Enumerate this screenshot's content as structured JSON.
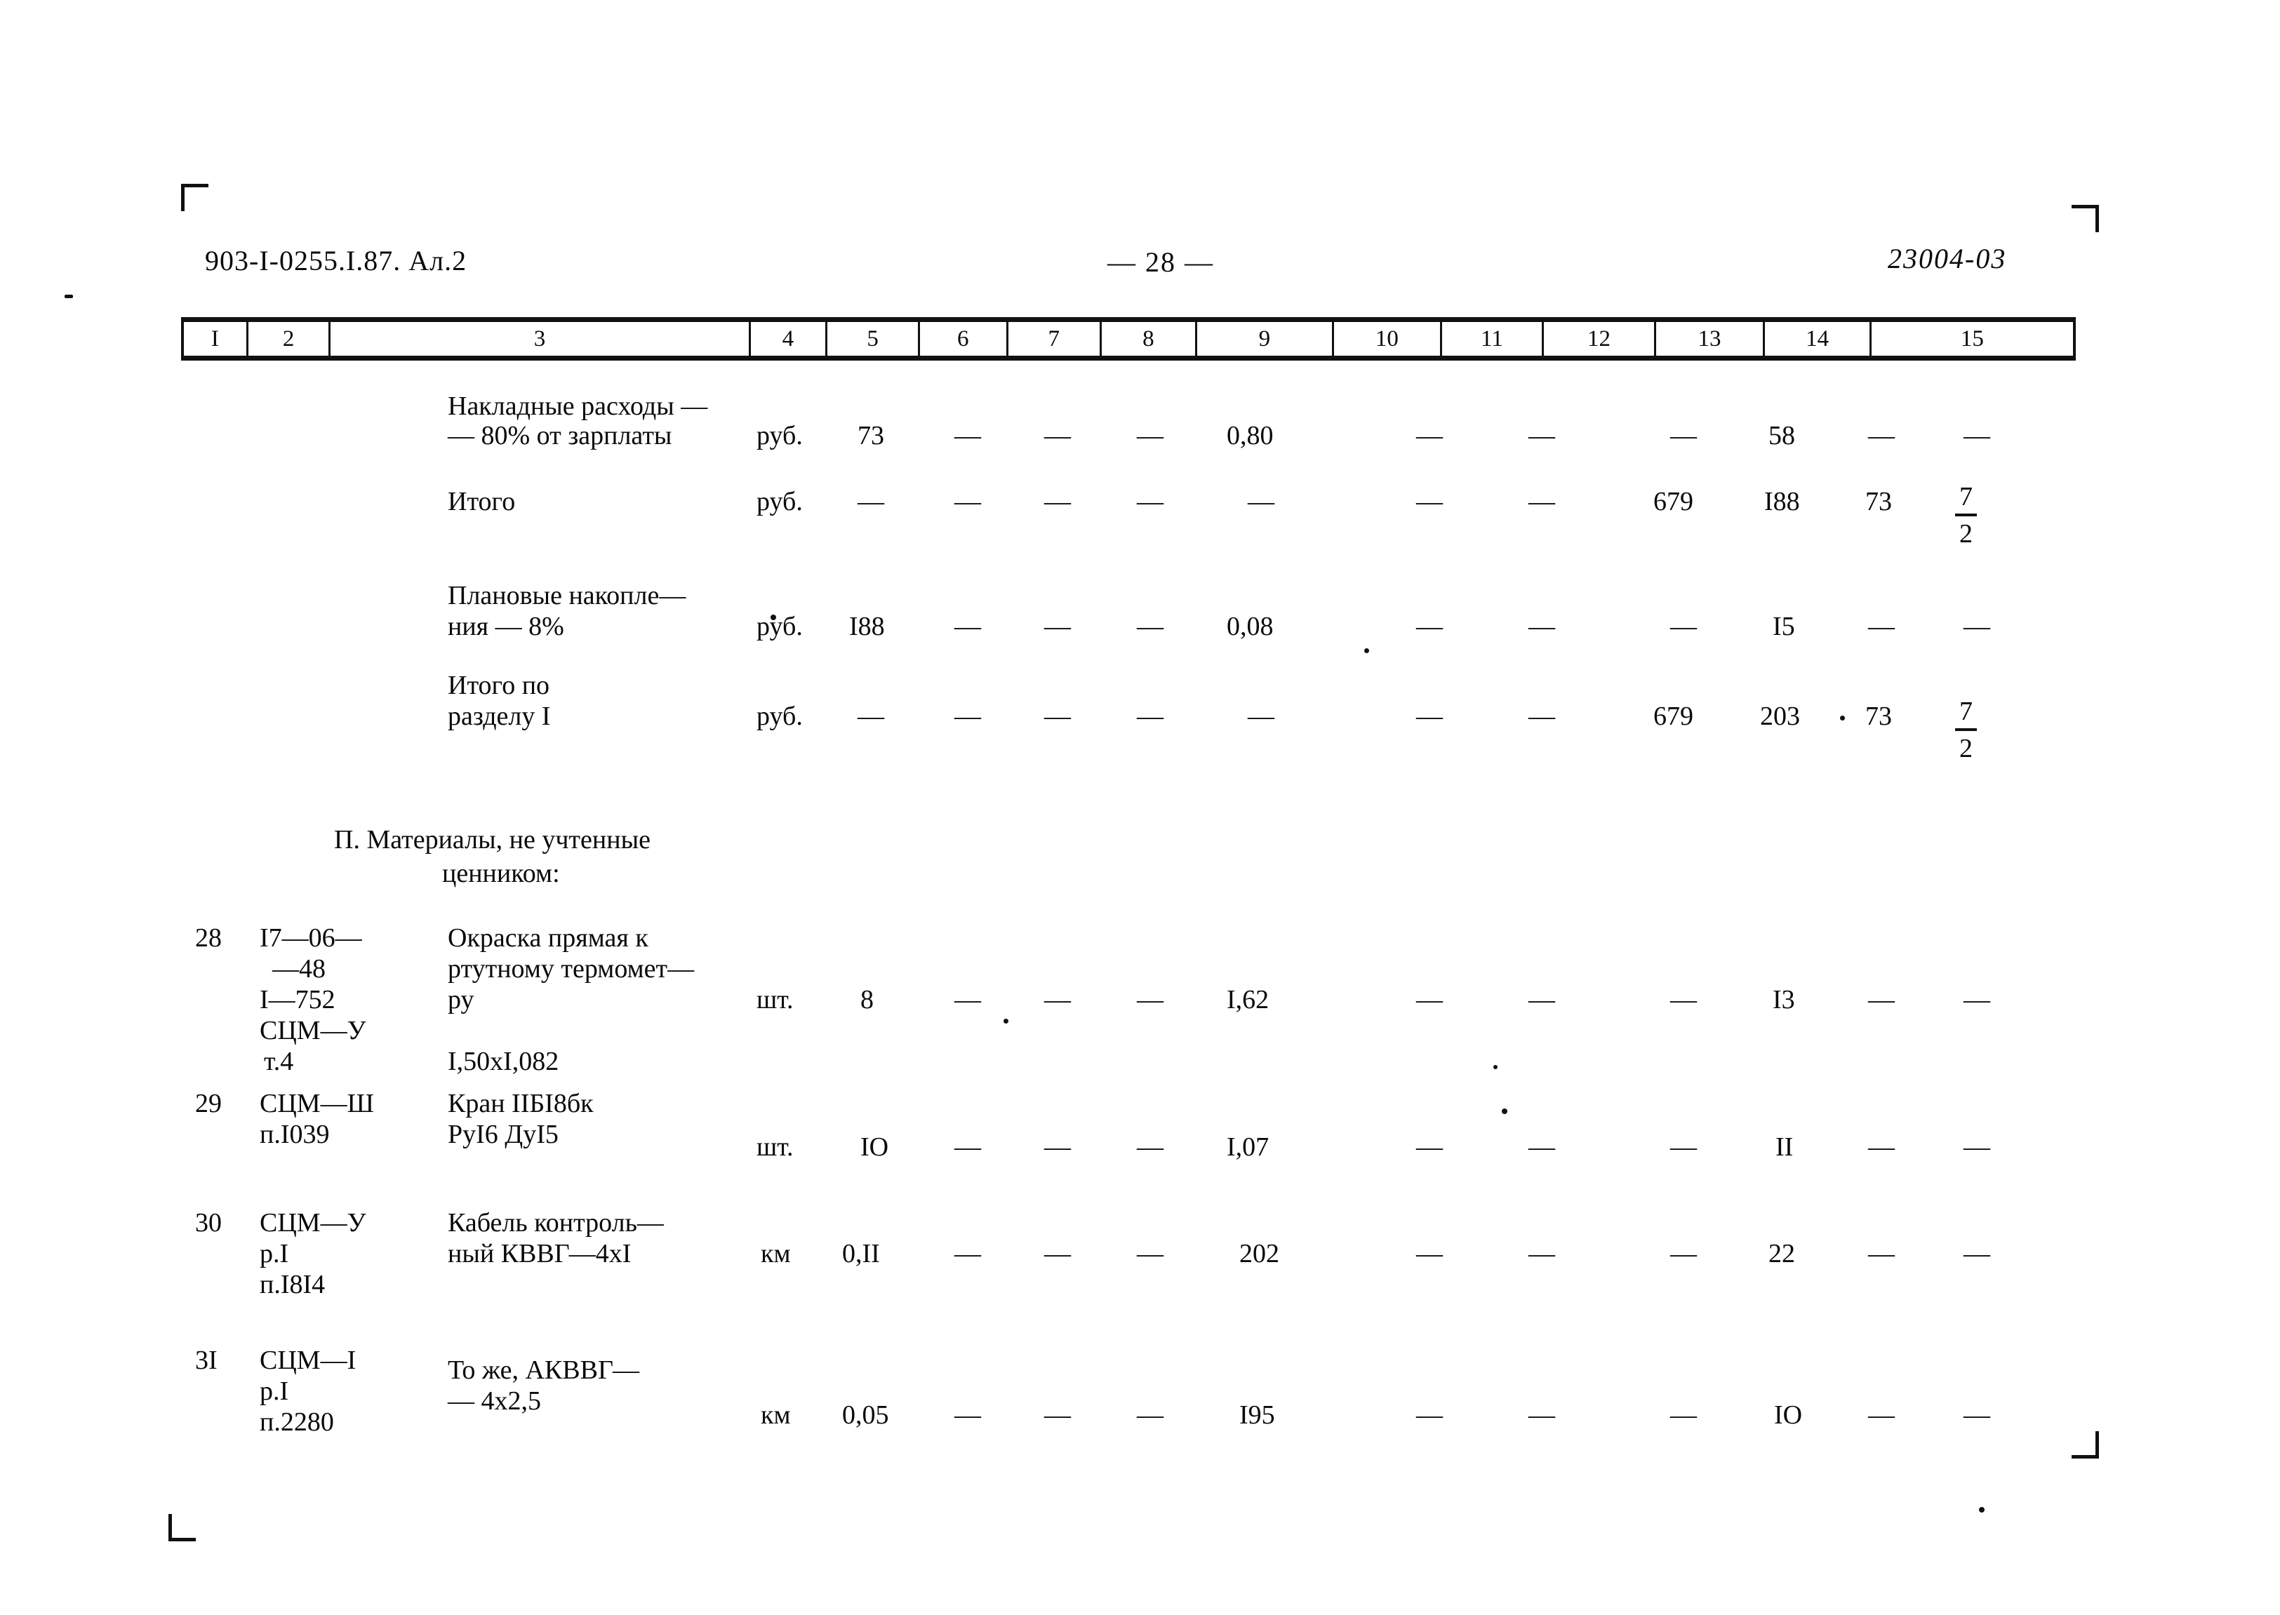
{
  "document": {
    "code_left": "903-I-0255.I.87. Ал.2",
    "page_marker": "— 28 —",
    "code_right": "23004-03"
  },
  "table": {
    "column_numbers": [
      "I",
      "2",
      "3",
      "4",
      "5",
      "6",
      "7",
      "8",
      "9",
      "10",
      "11",
      "12",
      "13",
      "14",
      "15"
    ],
    "dash": "—",
    "rows": [
      {
        "name": "overhead-costs",
        "num": "",
        "code": "",
        "desc_line1": "Накладные расходы —",
        "desc_line2": "— 80% от зарплаты",
        "unit": "руб.",
        "c5": "73",
        "c6": "—",
        "c7": "—",
        "c8": "—",
        "c9": "0,80",
        "c10": "—",
        "c11": "—",
        "c12": "—",
        "c13": "58",
        "c14": "—",
        "c15": "—"
      },
      {
        "name": "subtotal",
        "num": "",
        "code": "",
        "desc_line1": "Итого",
        "desc_line2": "",
        "unit": "руб.",
        "c5": "—",
        "c6": "—",
        "c7": "—",
        "c8": "—",
        "c9": "—",
        "c10": "—",
        "c11": "—",
        "c12": "679",
        "c13": "I88",
        "c14": "73",
        "c15_num": "7",
        "c15_den": "2"
      },
      {
        "name": "planned-savings",
        "num": "",
        "code": "",
        "desc_line1": "Плановые накопле—",
        "desc_line2": "ния — 8%",
        "unit": "руб.",
        "c5": "I88",
        "c6": "—",
        "c7": "—",
        "c8": "—",
        "c9": "0,08",
        "c10": "—",
        "c11": "—",
        "c12": "—",
        "c13": "I5",
        "c14": "—",
        "c15": "—"
      },
      {
        "name": "section-total",
        "num": "",
        "code": "",
        "desc_line1": "Итого по",
        "desc_line2": "разделу I",
        "unit": "руб.",
        "c5": "—",
        "c6": "—",
        "c7": "—",
        "c8": "—",
        "c9": "—",
        "c10": "—",
        "c11": "—",
        "c12": "679",
        "c13": "203",
        "c14": "73",
        "c15_num": "7",
        "c15_den": "2"
      }
    ],
    "section_heading_line1": "П. Материалы, не учтенные",
    "section_heading_line2": "ценником:",
    "material_rows": [
      {
        "name": "row-28",
        "num": "28",
        "code_l1": "I7—06—",
        "code_l2": "—48",
        "code_l3": "I—752",
        "code_l4": "СЦМ—У",
        "code_l5": "т.4",
        "desc_l1": "Окраска прямая к",
        "desc_l2": "ртутному термомет—",
        "desc_l3": "ру",
        "desc_l4": "I,50хI,082",
        "unit": "шт.",
        "c5": "8",
        "c6": "—",
        "c7": "—",
        "c8": "—",
        "c9": "I,62",
        "c10": "—",
        "c11": "—",
        "c12": "—",
        "c13": "I3",
        "c14": "—",
        "c15": "—"
      },
      {
        "name": "row-29",
        "num": "29",
        "code_l1": "СЦМ—Ш",
        "code_l2": "п.I039",
        "code_l3": "",
        "code_l4": "",
        "code_l5": "",
        "desc_l1": "Кран IIБI8бк",
        "desc_l2": "РуI6 ДуI5",
        "desc_l3": "",
        "desc_l4": "",
        "unit": "шт.",
        "c5": "IO",
        "c6": "—",
        "c7": "—",
        "c8": "—",
        "c9": "I,07",
        "c10": "—",
        "c11": "—",
        "c12": "—",
        "c13": "II",
        "c14": "—",
        "c15": "—"
      },
      {
        "name": "row-30",
        "num": "30",
        "code_l1": "СЦМ—У",
        "code_l2": "р.I",
        "code_l3": "п.I8I4",
        "code_l4": "",
        "code_l5": "",
        "desc_l1": "Кабель контроль—",
        "desc_l2": "ный КВВГ—4хI",
        "desc_l3": "",
        "desc_l4": "",
        "unit": "км",
        "c5": "0,II",
        "c6": "—",
        "c7": "—",
        "c8": "—",
        "c9": "202",
        "c10": "—",
        "c11": "—",
        "c12": "—",
        "c13": "22",
        "c14": "—",
        "c15": "—"
      },
      {
        "name": "row-31",
        "num": "3I",
        "code_l1": "СЦМ—I",
        "code_l2": "р.I",
        "code_l3": "п.2280",
        "code_l4": "",
        "code_l5": "",
        "desc_l1": "То же, АКВВГ—",
        "desc_l2": "— 4х2,5",
        "desc_l3": "",
        "desc_l4": "",
        "unit": "км",
        "c5": "0,05",
        "c6": "—",
        "c7": "—",
        "c8": "—",
        "c9": "I95",
        "c10": "—",
        "c11": "—",
        "c12": "—",
        "c13": "IO",
        "c14": "—",
        "c15": "—"
      }
    ]
  }
}
